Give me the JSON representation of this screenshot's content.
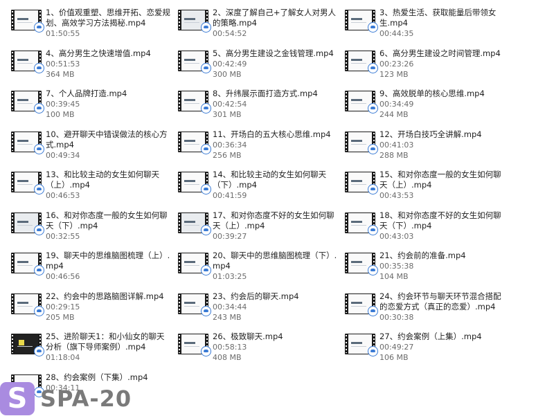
{
  "files": [
    {
      "name": "1、价值观重塑、思维开拓、恋爱规划、高效学习方法揭秘.mp4",
      "duration": "01:50:55",
      "size": ""
    },
    {
      "name": "2、深度了解自己+了解女人对男人的策略.mp4",
      "duration": "00:54:52",
      "size": ""
    },
    {
      "name": "3、热爱生活、获取能量后带领女生.mp4",
      "duration": "00:44:35",
      "size": ""
    },
    {
      "name": "4、高分男生之快速增值.mp4",
      "duration": "00:51:53",
      "size": "364 MB"
    },
    {
      "name": "5、高分男生建设之金钱管理.mp4",
      "duration": "00:42:49",
      "size": "300 MB"
    },
    {
      "name": "6、高分男生建设之时间管理.mp4",
      "duration": "00:23:26",
      "size": "123 MB"
    },
    {
      "name": "7、个人品牌打造.mp4",
      "duration": "00:39:45",
      "size": "100 MB"
    },
    {
      "name": "8、升纬展示面打造方式.mp4",
      "duration": "00:42:54",
      "size": "301 MB"
    },
    {
      "name": "9、高效脱单的核心思维.mp4",
      "duration": "00:34:49",
      "size": "244 MB"
    },
    {
      "name": "10、避开聊天中错误做法的核心方式.mp4",
      "duration": "00:49:34",
      "size": ""
    },
    {
      "name": "11、开场白的五大核心思维.mp4",
      "duration": "00:36:34",
      "size": "256 MB"
    },
    {
      "name": "12、开场白技巧全讲解.mp4",
      "duration": "00:41:03",
      "size": "288 MB"
    },
    {
      "name": "13、和比较主动的女生如何聊天（上）.mp4",
      "duration": "00:46:53",
      "size": ""
    },
    {
      "name": "14、和比较主动的女生如何聊天（下）.mp4",
      "duration": "00:41:59",
      "size": ""
    },
    {
      "name": "15、和对你态度一般的女生如何聊天（上）.mp4",
      "duration": "00:43:53",
      "size": ""
    },
    {
      "name": "16、和对你态度一般的女生如何聊天（下）.mp4",
      "duration": "00:32:55",
      "size": ""
    },
    {
      "name": "17、和对你态度不好的女生如何聊天（上）.mp4",
      "duration": "00:39:27",
      "size": ""
    },
    {
      "name": "18、和对你态度不好的女生如何聊天（下）.mp4",
      "duration": "00:43:03",
      "size": ""
    },
    {
      "name": "19、聊天中的思维脑图梳理（上）.mp4",
      "duration": "00:46:56",
      "size": ""
    },
    {
      "name": "20、聊天中的思维脑图梳理（下）.mp4",
      "duration": "01:03:25",
      "size": ""
    },
    {
      "name": "21、约会前的准备.mp4",
      "duration": "00:35:38",
      "size": "104 MB"
    },
    {
      "name": "22、约会中的思路脑图详解.mp4",
      "duration": "00:29:15",
      "size": "205 MB"
    },
    {
      "name": "23、约会后的聊天.mp4",
      "duration": "00:34:44",
      "size": "243 MB"
    },
    {
      "name": "24、约会环节与聊天环节混合搭配的恋爱方式（真正的恋爱）.mp4",
      "duration": "00:30:38",
      "size": ""
    },
    {
      "name": "25、进阶聊天1：和小仙女的聊天分析（旗下导师案例）.mp4",
      "duration": "01:18:04",
      "size": ""
    },
    {
      "name": "26、极致聊天.mp4",
      "duration": "00:58:13",
      "size": "408 MB"
    },
    {
      "name": "27、约会案例（上集）.mp4",
      "duration": "00:49:27",
      "size": "106 MB"
    },
    {
      "name": "28、约会案例（下集）.mp4",
      "duration": "00:34:11",
      "size": ""
    }
  ],
  "watermark": {
    "letter": "S",
    "text": "SPA-20"
  }
}
